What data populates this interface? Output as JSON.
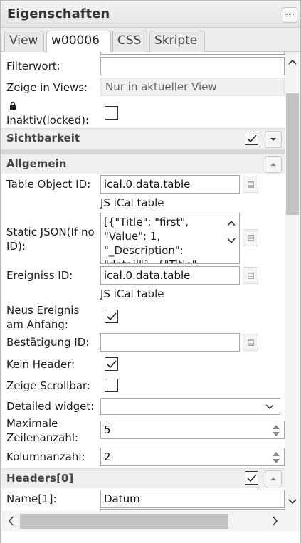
{
  "window": {
    "title": "Eigenschaften"
  },
  "tabs": [
    {
      "label": "View"
    },
    {
      "label": "w00006"
    },
    {
      "label": "CSS"
    },
    {
      "label": "Skripte"
    }
  ],
  "fields": {
    "filter_label": "Filterwort:",
    "filter_value": "",
    "views_label": "Zeige in Views:",
    "views_value": "Nur in aktueller View",
    "locked_label": "Inaktiv(locked):",
    "locked_checked": false
  },
  "sections": {
    "visibility": {
      "title": "Sichtbarkeit",
      "checked": true
    },
    "general": {
      "title": "Allgemein"
    },
    "headers": {
      "title": "Headers[0]",
      "checked": true
    }
  },
  "general": {
    "table_id_label": "Table Object ID:",
    "table_id_value": "ical.0.data.table",
    "table_id_sub": "JS iCal table",
    "static_json_label": "Static JSON(If no ID):",
    "static_json_lines": [
      "[{\"Title\": \"first\",",
      "\"Value\": 1,",
      "\"_Description\":",
      "\"detail\"}, {\"Title\":"
    ],
    "event_id_label": "Ereigniss ID:",
    "event_id_value": "ical.0.data.table",
    "event_id_sub": "JS iCal table",
    "new_event_label": "Neus Ereignis am Anfang:",
    "new_event_checked": true,
    "confirm_label": "Bestätigung ID:",
    "confirm_value": "",
    "no_header_label": "Kein Header:",
    "no_header_checked": true,
    "scrollbar_label": "Zeige Scrollbar:",
    "scrollbar_checked": false,
    "detailed_label": "Detailed widget:",
    "detailed_value": "",
    "max_rows_label": "Maximale Zeilenanzahl:",
    "max_rows_value": "5",
    "columns_label": "Kolumnanzahl:",
    "columns_value": "2"
  },
  "headers": {
    "name1_label": "Name[1]:",
    "name1_value": "Datum"
  },
  "icons": {
    "lock": "lock-icon",
    "close": "close-icon",
    "select": "object-select-icon"
  }
}
